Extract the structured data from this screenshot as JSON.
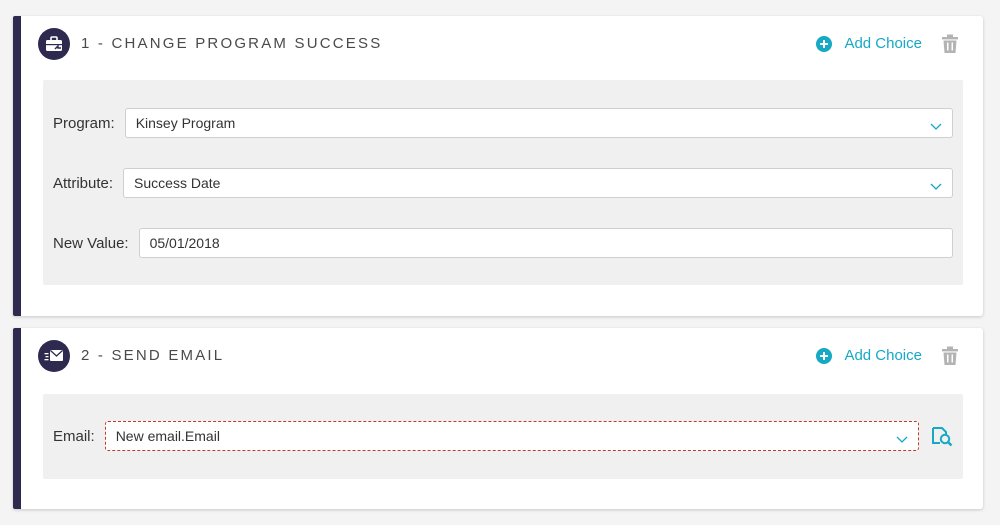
{
  "steps": [
    {
      "title": "1 - CHANGE PROGRAM SUCCESS",
      "add_choice_label": "Add Choice",
      "icon": "briefcase-icon",
      "fields": {
        "program_label": "Program:",
        "program_value": "Kinsey Program",
        "attribute_label": "Attribute:",
        "attribute_value": "Success Date",
        "new_value_label": "New Value:",
        "new_value_value": "05/01/2018"
      }
    },
    {
      "title": "2 - SEND EMAIL",
      "add_choice_label": "Add Choice",
      "icon": "email-send-icon",
      "fields": {
        "email_label": "Email:",
        "email_value": "New email.Email"
      }
    }
  ],
  "colors": {
    "accent": "#15a9c5",
    "step_bar": "#2e2a4f",
    "panel_bg": "#f0f0f0",
    "error_border": "#c0392b",
    "trash": "#b3b3b3"
  }
}
